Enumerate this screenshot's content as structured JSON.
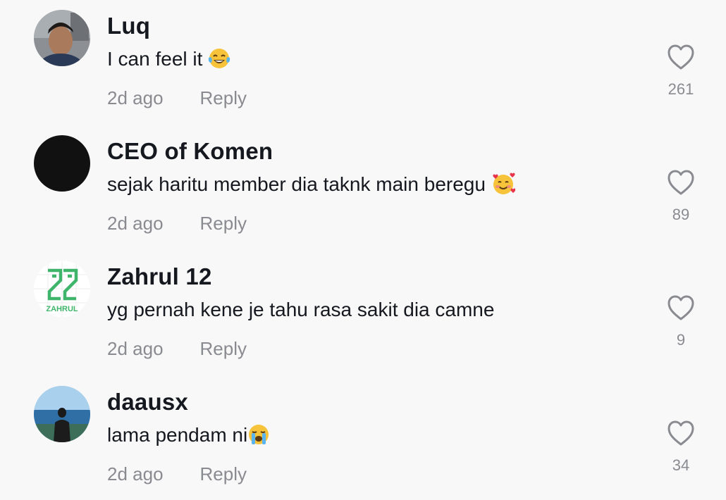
{
  "comments": [
    {
      "username": "Luq",
      "text": "I can feel it",
      "emoji": "tears-of-joy-emoji",
      "time": "2d ago",
      "reply_label": "Reply",
      "likes": "261"
    },
    {
      "username": "CEO of Komen",
      "text": "sejak haritu member dia taknk main beregu",
      "emoji": "smiling-face-with-hearts-emoji",
      "time": "2d ago",
      "reply_label": "Reply",
      "likes": "89"
    },
    {
      "username": "Zahrul 12",
      "text": "yg pernah kene je tahu rasa sakit dia camne",
      "avatar_logo_text": "ZAHRUL",
      "time": "2d ago",
      "reply_label": "Reply",
      "likes": "9"
    },
    {
      "username": "daausx",
      "text": "lama pendam ni",
      "emoji": "loudly-crying-face-emoji",
      "time": "2d ago",
      "reply_label": "Reply",
      "likes": "34"
    }
  ],
  "colors": {
    "background": "#f8f8f8",
    "text_primary": "#16181f",
    "text_secondary": "#8a8b91",
    "zahrul_logo_green": "#3fb56b"
  },
  "icons": {
    "like": "heart-outline-icon"
  }
}
